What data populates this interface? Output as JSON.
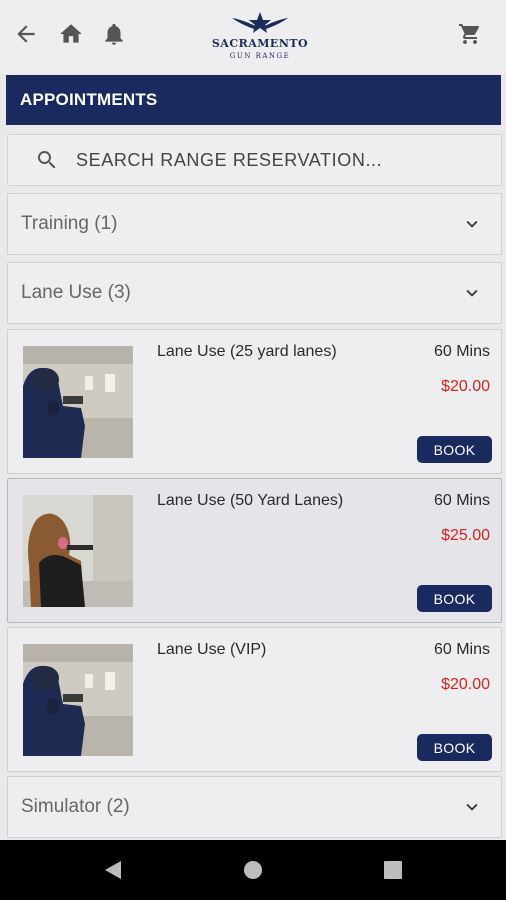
{
  "topbar": {
    "back_icon": "arrow-left-icon",
    "home_icon": "home-icon",
    "notifications_icon": "bell-icon",
    "cart_icon": "cart-icon",
    "logo": {
      "name": "SACRAMENTO",
      "sub": "GUN RANGE"
    }
  },
  "header": {
    "title": "APPOINTMENTS"
  },
  "search": {
    "placeholder": "SEARCH RANGE RESERVATION..."
  },
  "categories": {
    "training": {
      "label": "Training (1)"
    },
    "lane_use": {
      "label": "Lane Use (3)"
    },
    "simulator": {
      "label": "Simulator (2)"
    }
  },
  "products": [
    {
      "name": "Lane Use (25 yard lanes)",
      "duration": "60 Mins",
      "price": "$20.00",
      "button": "BOOK"
    },
    {
      "name": "Lane Use (50 Yard Lanes)",
      "duration": "60 Mins",
      "price": "$25.00",
      "button": "BOOK"
    },
    {
      "name": "Lane Use (VIP)",
      "duration": "60 Mins",
      "price": "$20.00",
      "button": "BOOK"
    }
  ],
  "colors": {
    "brand": "#1b2a5e",
    "price": "#d62222"
  }
}
